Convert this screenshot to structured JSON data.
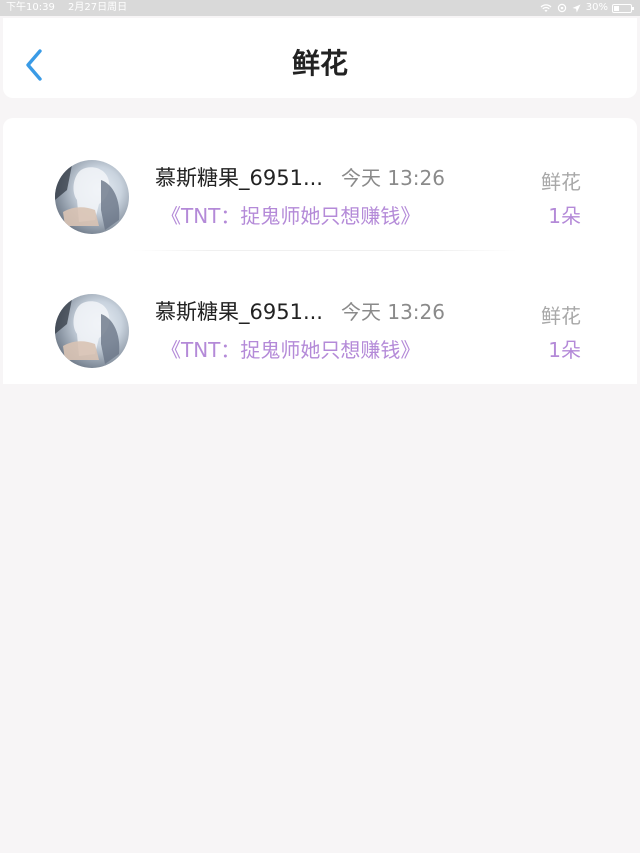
{
  "status_bar": {
    "time": "下午10:39",
    "date": "2月27日周日",
    "battery": "30%",
    "battery_level": 0.3,
    "icons": [
      "wifi-icon",
      "location-icon",
      "battery-icon"
    ]
  },
  "header": {
    "title": "鲜花",
    "back_icon": "chevron-left-icon",
    "accent_color": "#3a9be6"
  },
  "records": [
    {
      "user": "慕斯糖果_6951...",
      "time": "今天 13:26",
      "book": "《TNT：捉鬼师她只想赚钱》",
      "gift_type": "鲜花",
      "gift_count": "1朵"
    },
    {
      "user": "慕斯糖果_6951...",
      "time": "今天 13:26",
      "book": "《TNT：捉鬼师她只想赚钱》",
      "gift_type": "鲜花",
      "gift_count": "1朵"
    }
  ],
  "colors": {
    "book_title": "#b48ad8",
    "gift_count": "#b48ad8",
    "background": "#f7f5f6"
  }
}
